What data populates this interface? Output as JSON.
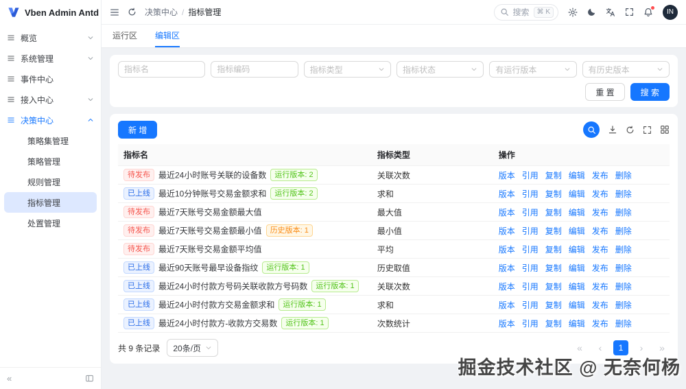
{
  "header": {
    "logo": "Vben Admin Antd",
    "breadcrumb": [
      "决策中心",
      "指标管理"
    ],
    "search": {
      "label": "搜索",
      "shortcut": "⌘ K"
    },
    "avatar": "IN"
  },
  "sidebar": {
    "items": [
      {
        "label": "概览",
        "chevron": "down"
      },
      {
        "label": "系统管理",
        "chevron": "down"
      },
      {
        "label": "事件中心"
      },
      {
        "label": "接入中心",
        "chevron": "down"
      },
      {
        "label": "决策中心",
        "chevron": "up",
        "active": true,
        "children": [
          {
            "label": "策略集管理"
          },
          {
            "label": "策略管理"
          },
          {
            "label": "规则管理"
          },
          {
            "label": "指标管理",
            "active": true
          },
          {
            "label": "处置管理"
          }
        ]
      }
    ]
  },
  "tabs": [
    {
      "label": "运行区",
      "active": false
    },
    {
      "label": "编辑区",
      "active": true
    }
  ],
  "filters": {
    "fields": [
      {
        "placeholder": "指标名",
        "type": "input"
      },
      {
        "placeholder": "指标编码",
        "type": "input"
      },
      {
        "placeholder": "指标类型",
        "type": "select"
      },
      {
        "placeholder": "指标状态",
        "type": "select"
      },
      {
        "placeholder": "有运行版本",
        "type": "select"
      },
      {
        "placeholder": "有历史版本",
        "type": "select"
      }
    ],
    "reset": "重 置",
    "search": "搜 索"
  },
  "toolbar": {
    "add": "新 增"
  },
  "table": {
    "headers": [
      "指标名",
      "指标类型",
      "操作"
    ],
    "action_labels": [
      "版本",
      "引用",
      "复制",
      "编辑",
      "发布",
      "删除"
    ],
    "rows": [
      {
        "status": "待发布",
        "status_color": "red",
        "name": "最近24小时账号关联的设备数",
        "tag": "运行版本: 2",
        "tag_color": "green",
        "type": "关联次数"
      },
      {
        "status": "已上线",
        "status_color": "blue",
        "name": "最近10分钟账号交易金额求和",
        "tag": "运行版本: 2",
        "tag_color": "green",
        "type": "求和"
      },
      {
        "status": "待发布",
        "status_color": "red",
        "name": "最近7天账号交易金额最大值",
        "tag": "",
        "tag_color": "",
        "type": "最大值"
      },
      {
        "status": "待发布",
        "status_color": "red",
        "name": "最近7天账号交易金额最小值",
        "tag": "历史版本: 1",
        "tag_color": "orange",
        "type": "最小值"
      },
      {
        "status": "待发布",
        "status_color": "red",
        "name": "最近7天账号交易金额平均值",
        "tag": "",
        "tag_color": "",
        "type": "平均"
      },
      {
        "status": "已上线",
        "status_color": "blue",
        "name": "最近90天账号最早设备指纹",
        "tag": "运行版本: 1",
        "tag_color": "green",
        "type": "历史取值"
      },
      {
        "status": "已上线",
        "status_color": "blue",
        "name": "最近24小时付款方号码关联收款方号码数",
        "tag": "运行版本: 1",
        "tag_color": "green",
        "type": "关联次数"
      },
      {
        "status": "已上线",
        "status_color": "blue",
        "name": "最近24小时付款方交易金额求和",
        "tag": "运行版本: 1",
        "tag_color": "green",
        "type": "求和"
      },
      {
        "status": "已上线",
        "status_color": "blue",
        "name": "最近24小时付款方-收款方交易数",
        "tag": "运行版本: 1",
        "tag_color": "green",
        "type": "次数统计"
      }
    ]
  },
  "pagination": {
    "total": "共 9 条记录",
    "page_size": "20条/页",
    "current": "1"
  },
  "watermark": "掘金技术社区 @ 无奈何杨",
  "colors": {
    "primary": "#1677ff",
    "status_pending": "#f5564e",
    "status_online": "#2b6de8",
    "tag_run_version": "#52c41a",
    "tag_history_version": "#fa8c16"
  }
}
